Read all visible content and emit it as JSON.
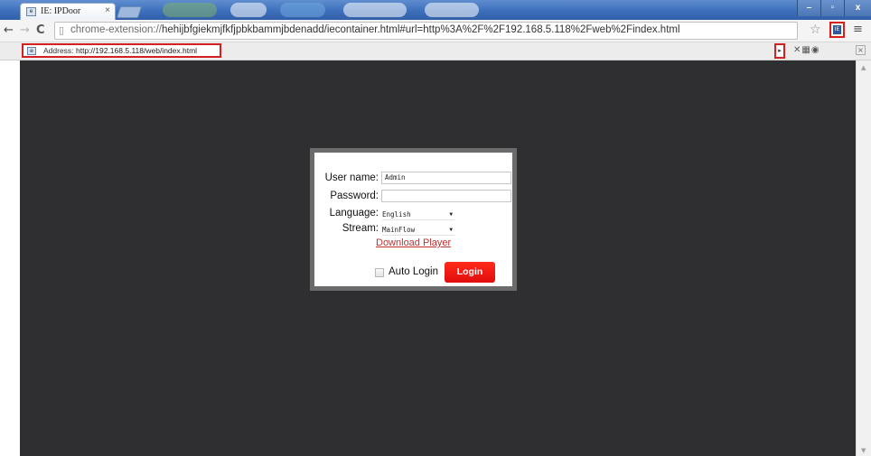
{
  "browser": {
    "tab_title": "IE: IPDoor",
    "tab_close": "×",
    "url_host": "chrome-extension://",
    "url_rest": "hehijbfgiekmjfkfjpbkbammjbdenadd/iecontainer.html#url=http%3A%2F%2F192.168.5.118%2Fweb%2Findex.html",
    "window_minimize": "–",
    "window_maximize": "▫",
    "window_close": "x",
    "icons": {
      "back": "back-arrow-icon",
      "forward": "forward-arrow-icon",
      "reload": "reload-icon",
      "page": "page-icon",
      "star": "bookmark-star-icon",
      "extension": "ie-tab-extension-icon",
      "menu": "menu-icon"
    },
    "glyphs": {
      "back": "←",
      "forward": "→",
      "reload": "C",
      "page": "▯",
      "star": "☆",
      "menu": "≡",
      "ext": "IE"
    }
  },
  "ie_tab": {
    "address_label": "Address:",
    "address_value": "http://192.168.5.118/web/index.html",
    "go_glyph": "▸",
    "tools_glyphs": "✕▦◉",
    "close_glyph": "×"
  },
  "login": {
    "username_label": "User name:",
    "username_value": "Admin",
    "password_label": "Password:",
    "password_value": "",
    "language_label": "Language:",
    "language_value": "English",
    "stream_label": "Stream:",
    "stream_value": "MainFlow",
    "download_link": "Download Player",
    "auto_login_label": "Auto Login",
    "auto_login_checked": false,
    "login_button": "Login"
  },
  "colors": {
    "page_background": "#2f2f32",
    "login_button": "#f01a12",
    "link": "#b83232",
    "highlight_border": "#d52020"
  }
}
